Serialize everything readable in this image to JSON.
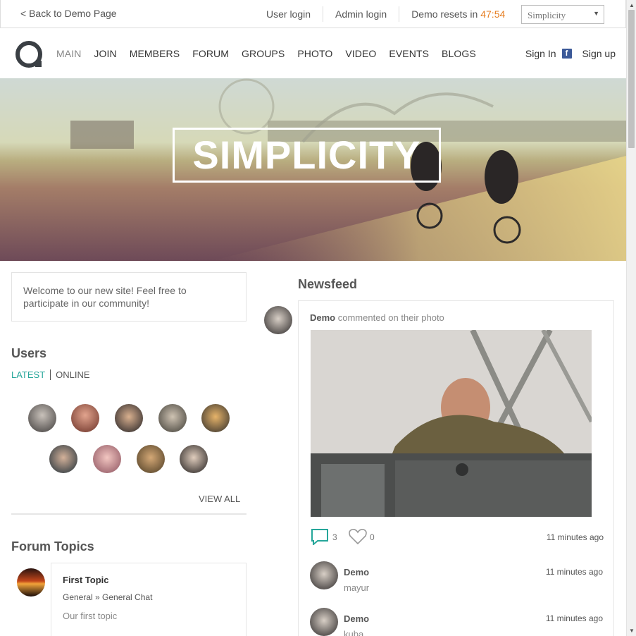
{
  "demobar": {
    "back": "< Back to Demo Page",
    "user_login": "User login",
    "admin_login": "Admin login",
    "resets_label": "Demo resets in",
    "resets_time": "47:54",
    "theme_select": "Simplicity"
  },
  "nav": {
    "items": [
      "MAIN",
      "JOIN",
      "MEMBERS",
      "FORUM",
      "GROUPS",
      "PHOTO",
      "VIDEO",
      "EVENTS",
      "BLOGS"
    ],
    "sign_in": "Sign In",
    "facebook": "f",
    "sign_up": "Sign up"
  },
  "hero": {
    "title": "SIMPLICITY"
  },
  "welcome": "Welcome to our new site! Feel free to participate in our community!",
  "users": {
    "title": "Users",
    "tab_latest": "LATEST",
    "tab_online": "ONLINE",
    "view_all": "VIEW ALL"
  },
  "forum": {
    "title": "Forum Topics",
    "topic_title": "First Topic",
    "crumb": "General » General Chat",
    "desc": "Our first topic"
  },
  "newsfeed": {
    "title": "Newsfeed",
    "author": "Demo",
    "action": "commented on their photo",
    "comments_count": "3",
    "likes_count": "0",
    "time": "11 minutes ago",
    "comments": [
      {
        "name": "Demo",
        "text": "mayur",
        "time": "11 minutes ago"
      },
      {
        "name": "Demo",
        "text": "kuba",
        "time": "11 minutes ago"
      }
    ]
  },
  "colors": {
    "accent": "#26a69a",
    "timer": "#e67e22",
    "facebook": "#3b5998"
  }
}
